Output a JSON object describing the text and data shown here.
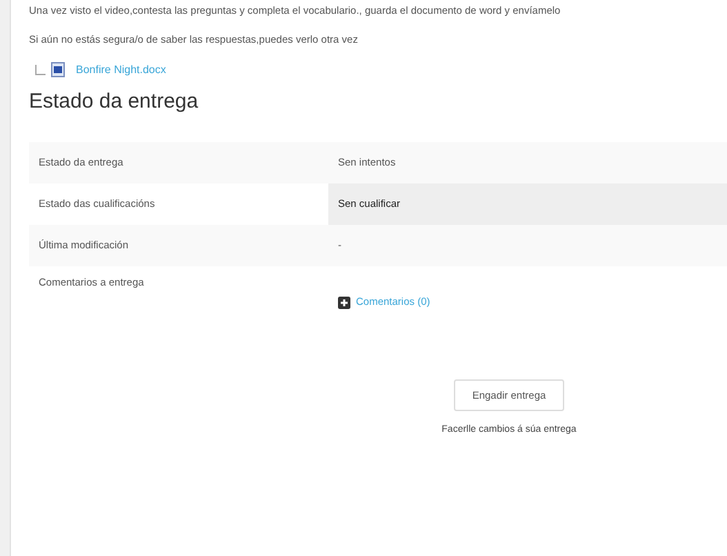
{
  "intro": [
    "Una vez visto el video,contesta las preguntas y completa el vocabulario., guarda el documento de word y envíamelo",
    "Si aún no estás segura/o de saber las respuestas,puedes verlo otra vez"
  ],
  "attachment": {
    "name": "Bonfire Night.docx"
  },
  "heading": "Estado da entrega",
  "rows": [
    {
      "label": "Estado da entrega",
      "kind": "text",
      "value": "Sen intentos",
      "highlighted": false
    },
    {
      "label": "Estado das cualificacións",
      "kind": "text",
      "value": "Sen cualificar",
      "highlighted": true
    },
    {
      "label": "Última modificación",
      "kind": "text",
      "value": "-",
      "highlighted": false
    },
    {
      "label": "Comentarios a entrega",
      "kind": "link",
      "value": "Comentarios (0)"
    }
  ],
  "button": "Engadir entrega",
  "note": "Facerlle cambios á súa entrega"
}
